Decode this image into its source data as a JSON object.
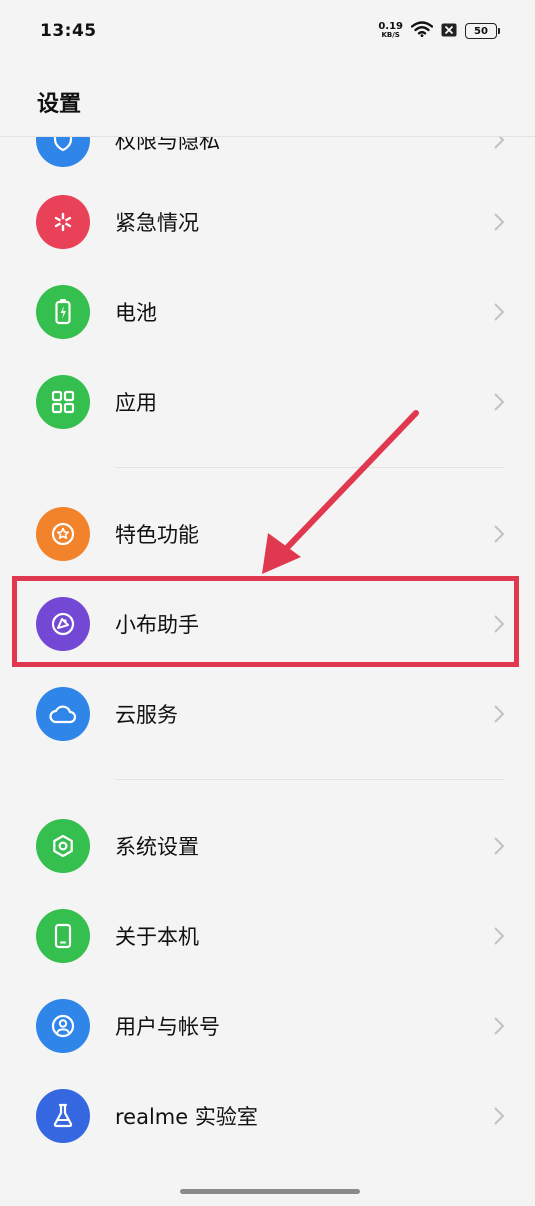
{
  "status_bar": {
    "time": "13:45",
    "net_speed_value": "0.19",
    "net_speed_unit": "KB/S",
    "battery": "50"
  },
  "header": {
    "title": "设置"
  },
  "items": [
    {
      "label": "权限与隐私",
      "icon": "shield-lock-icon",
      "color": "#2f86e8"
    },
    {
      "label": "紧急情况",
      "icon": "asterisk-icon",
      "color": "#e84158"
    },
    {
      "label": "电池",
      "icon": "battery-charging-icon",
      "color": "#35bf4e"
    },
    {
      "label": "应用",
      "icon": "apps-grid-icon",
      "color": "#35bf4e"
    },
    {
      "label": "特色功能",
      "icon": "star-badge-icon",
      "color": "#f2832a"
    },
    {
      "label": "小布助手",
      "icon": "assistant-icon",
      "color": "#7248d4"
    },
    {
      "label": "云服务",
      "icon": "cloud-icon",
      "color": "#2f86e8"
    },
    {
      "label": "系统设置",
      "icon": "hexagon-settings-icon",
      "color": "#35bf4e"
    },
    {
      "label": "关于本机",
      "icon": "phone-icon",
      "color": "#35bf4e"
    },
    {
      "label": "用户与帐号",
      "icon": "user-account-icon",
      "color": "#2f86e8"
    },
    {
      "label": "realme 实验室",
      "icon": "flask-icon",
      "color": "#3567e0"
    }
  ],
  "annotation": {
    "highlight_color": "#e0394f",
    "highlighted_item": "小布助手"
  }
}
